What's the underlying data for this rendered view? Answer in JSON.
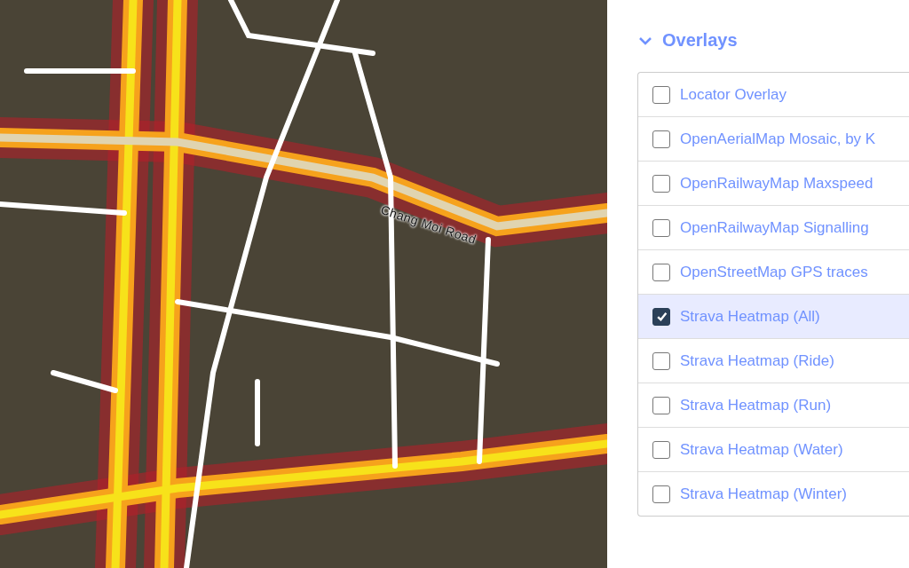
{
  "map": {
    "road_label": "Chang Moi Road"
  },
  "overlays": {
    "title": "Overlays",
    "expanded": true,
    "items": [
      {
        "label": "Locator Overlay",
        "checked": false
      },
      {
        "label": "OpenAerialMap Mosaic, by K",
        "checked": false
      },
      {
        "label": "OpenRailwayMap Maxspeed",
        "checked": false
      },
      {
        "label": "OpenRailwayMap Signalling",
        "checked": false
      },
      {
        "label": "OpenStreetMap GPS traces",
        "checked": false
      },
      {
        "label": "Strava Heatmap (All)",
        "checked": true
      },
      {
        "label": "Strava Heatmap (Ride)",
        "checked": false
      },
      {
        "label": "Strava Heatmap (Run)",
        "checked": false
      },
      {
        "label": "Strava Heatmap (Water)",
        "checked": false
      },
      {
        "label": "Strava Heatmap (Winter)",
        "checked": false
      }
    ]
  }
}
